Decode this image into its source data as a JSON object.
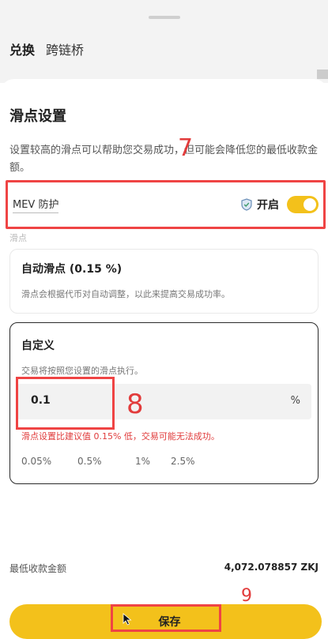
{
  "background": {
    "tabs": [
      "兑换",
      "跨链桥"
    ]
  },
  "sheet": {
    "title": "滑点设置",
    "description": "设置较高的滑点可以帮助您交易成功，但可能会降低您的最低收款金额。",
    "mev": {
      "label": "MEV 防护",
      "status": "开启",
      "enabled": true
    },
    "section_label": "滑点",
    "auto": {
      "title": "自动滑点 (0.15 %)",
      "subtitle": "滑点会根据代币对自动调整，以此来提高交易成功率。"
    },
    "custom": {
      "title": "自定义",
      "subtitle": "交易将按照您设置的滑点执行。",
      "value": "0.1",
      "unit": "%",
      "warning": "滑点设置比建议值 0.15% 低，交易可能无法成功。",
      "presets": [
        "0.05%",
        "0.5%",
        "1%",
        "2.5%"
      ]
    },
    "min_receive": {
      "label": "最低收款金额",
      "value": "4,072.078857 ZKJ"
    },
    "save_label": "保存"
  },
  "annotations": {
    "step7": "7",
    "step8": "8",
    "step9": "9"
  },
  "colors": {
    "accent": "#f3c11b",
    "annotation": "#ef4444",
    "warning": "#e03b3b"
  }
}
